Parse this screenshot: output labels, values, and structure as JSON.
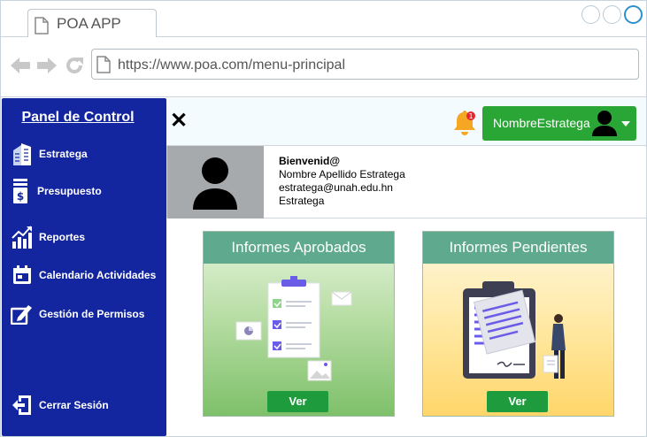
{
  "browser": {
    "tab_title": "POA APP",
    "url": "https://www.poa.com/menu-principal"
  },
  "sidebar": {
    "title": "Panel de Control",
    "items": [
      {
        "label": "Estratega",
        "icon": "building-icon"
      },
      {
        "label": "Presupuesto",
        "icon": "budget-icon"
      },
      {
        "label": "Reportes",
        "icon": "chart-icon"
      },
      {
        "label": "Calendario Actividades",
        "icon": "calendar-icon"
      },
      {
        "label": "Gestión de Permisos",
        "icon": "permission-icon"
      }
    ],
    "logout_label": "Cerrar Sesión"
  },
  "topbar": {
    "close_symbol": "✕",
    "notification_count": "1",
    "username": "NombreEstratega"
  },
  "profile": {
    "greeting": "Bienvenid@",
    "full_name": "Nombre Apellido Estratega",
    "email": "estratega@unah.edu.hn",
    "role": "Estratega"
  },
  "cards": [
    {
      "title": "Informes Aprobados",
      "button": "Ver"
    },
    {
      "title": "Informes Pendientes",
      "button": "Ver"
    }
  ],
  "colors": {
    "sidebar": "#1326a0",
    "accent_green": "#2aa637",
    "card_header": "#5fa98e"
  }
}
